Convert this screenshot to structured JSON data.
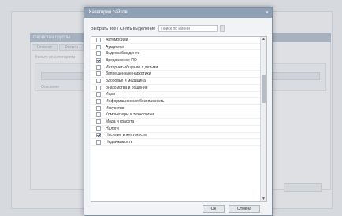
{
  "background": {
    "window_title": "Свойства группы",
    "tabs": [
      "Главное",
      "Фильтр"
    ],
    "section_label": "Фильтр по категориям",
    "row_button": "Категории",
    "field_label": "Описание"
  },
  "dialog": {
    "title": "Категории сайтов",
    "close_symbol": "×",
    "filter_label": "Выбрать все / Снять выделение",
    "filter_placeholder": "Поиск по имени",
    "items": [
      {
        "label": "Автомобили",
        "checked": false
      },
      {
        "label": "Аукционы",
        "checked": false
      },
      {
        "label": "Видеонаблюдение",
        "checked": false
      },
      {
        "label": "Вредоносное ПО",
        "checked": true
      },
      {
        "label": "Интернет-общение с детьми",
        "checked": false
      },
      {
        "label": "Запрещенные наркотики",
        "checked": false
      },
      {
        "label": "Здоровье и медицина",
        "checked": false
      },
      {
        "label": "Знакомства и общение",
        "checked": false
      },
      {
        "label": "Игры",
        "checked": false
      },
      {
        "label": "Информационная безопасность",
        "checked": false
      },
      {
        "label": "Искусство",
        "checked": false
      },
      {
        "label": "Компьютеры и технологии",
        "checked": false
      },
      {
        "label": "Мода и красота",
        "checked": false
      },
      {
        "label": "Налоги",
        "checked": false
      },
      {
        "label": "Насилие и жестокость",
        "checked": true
      },
      {
        "label": "Недвижимость",
        "checked": false
      }
    ],
    "ok_label": "ОК",
    "cancel_label": "Отмена"
  }
}
